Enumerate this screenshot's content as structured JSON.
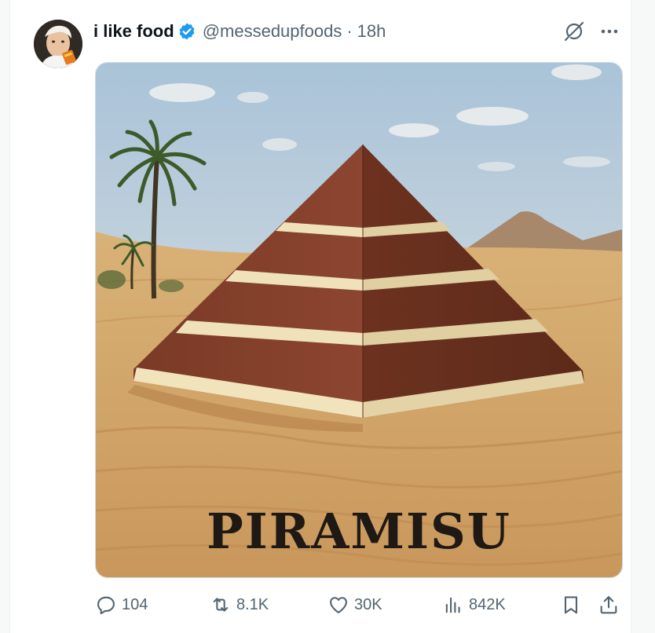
{
  "tweet": {
    "display_name": "i like food",
    "handle": "@messedupfoods",
    "separator": "·",
    "time": "18h",
    "verified": true,
    "media_text": "PIRAMISU"
  },
  "actions": {
    "replies": "104",
    "retweets": "8.1K",
    "likes": "30K",
    "views": "842K"
  },
  "icons": {
    "header": [
      "verified-badge-icon",
      "grok-icon",
      "more-icon"
    ],
    "actions": [
      "reply-icon",
      "retweet-icon",
      "like-icon",
      "views-icon",
      "bookmark-icon",
      "share-icon"
    ]
  },
  "colors": {
    "verified": "#1d9bf0",
    "text": "#0f1419",
    "secondary_text": "#536471",
    "border": "#cfd9de"
  }
}
